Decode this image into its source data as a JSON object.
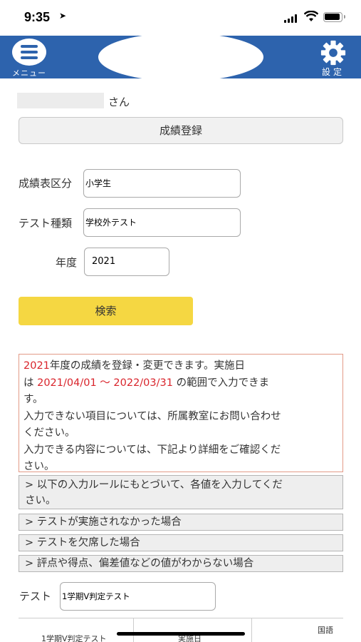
{
  "status_bar": {
    "time": "9:35",
    "location_icon": "location-arrow-icon",
    "signal_icon": "cellular-signal-icon",
    "wifi_icon": "wifi-icon",
    "battery_icon": "battery-icon"
  },
  "header": {
    "menu_label": "メニュー",
    "settings_label": "設定",
    "brand_color": "#2d63ad"
  },
  "user": {
    "suffix": "さん"
  },
  "page": {
    "title": "成績登録"
  },
  "form": {
    "category_label": "成績表区分",
    "category_value": "小学生",
    "test_type_label": "テスト種類",
    "test_type_value": "学校外テスト",
    "year_label": "年度",
    "year_value": "2021",
    "search_label": "検索",
    "search_color": "#f5d742"
  },
  "notice": {
    "year": "2021",
    "line1_rest": "年度の成績を登録・変更できます。実施日",
    "line2_prefix": "は ",
    "date_range": "2021/04/01 〜 2022/03/31",
    "line2_rest": " の範囲で入力できま",
    "line3": "す。",
    "line4": "入力できない項目については、所属教室にお問い合わせ",
    "line5": "ください。",
    "line6": "入力できる内容については、下記より詳細をご確認くだ",
    "line7": "さい。"
  },
  "accordions": [
    {
      "line1": "> 以下の入力ルールにもとづいて、各値を入力してくだ",
      "line2": "さい。"
    },
    {
      "line1": "> テストが実施されなかった場合"
    },
    {
      "line1": "> テストを欠席した場合"
    },
    {
      "line1": "> 評点や得点、偏差値などの値がわからない場合"
    }
  ],
  "test_select": {
    "label": "テスト",
    "value": "1学期V判定テスト"
  },
  "table": {
    "row_label": "1学期V判定テスト",
    "col_date": "実施日",
    "col_subject": "国語"
  }
}
